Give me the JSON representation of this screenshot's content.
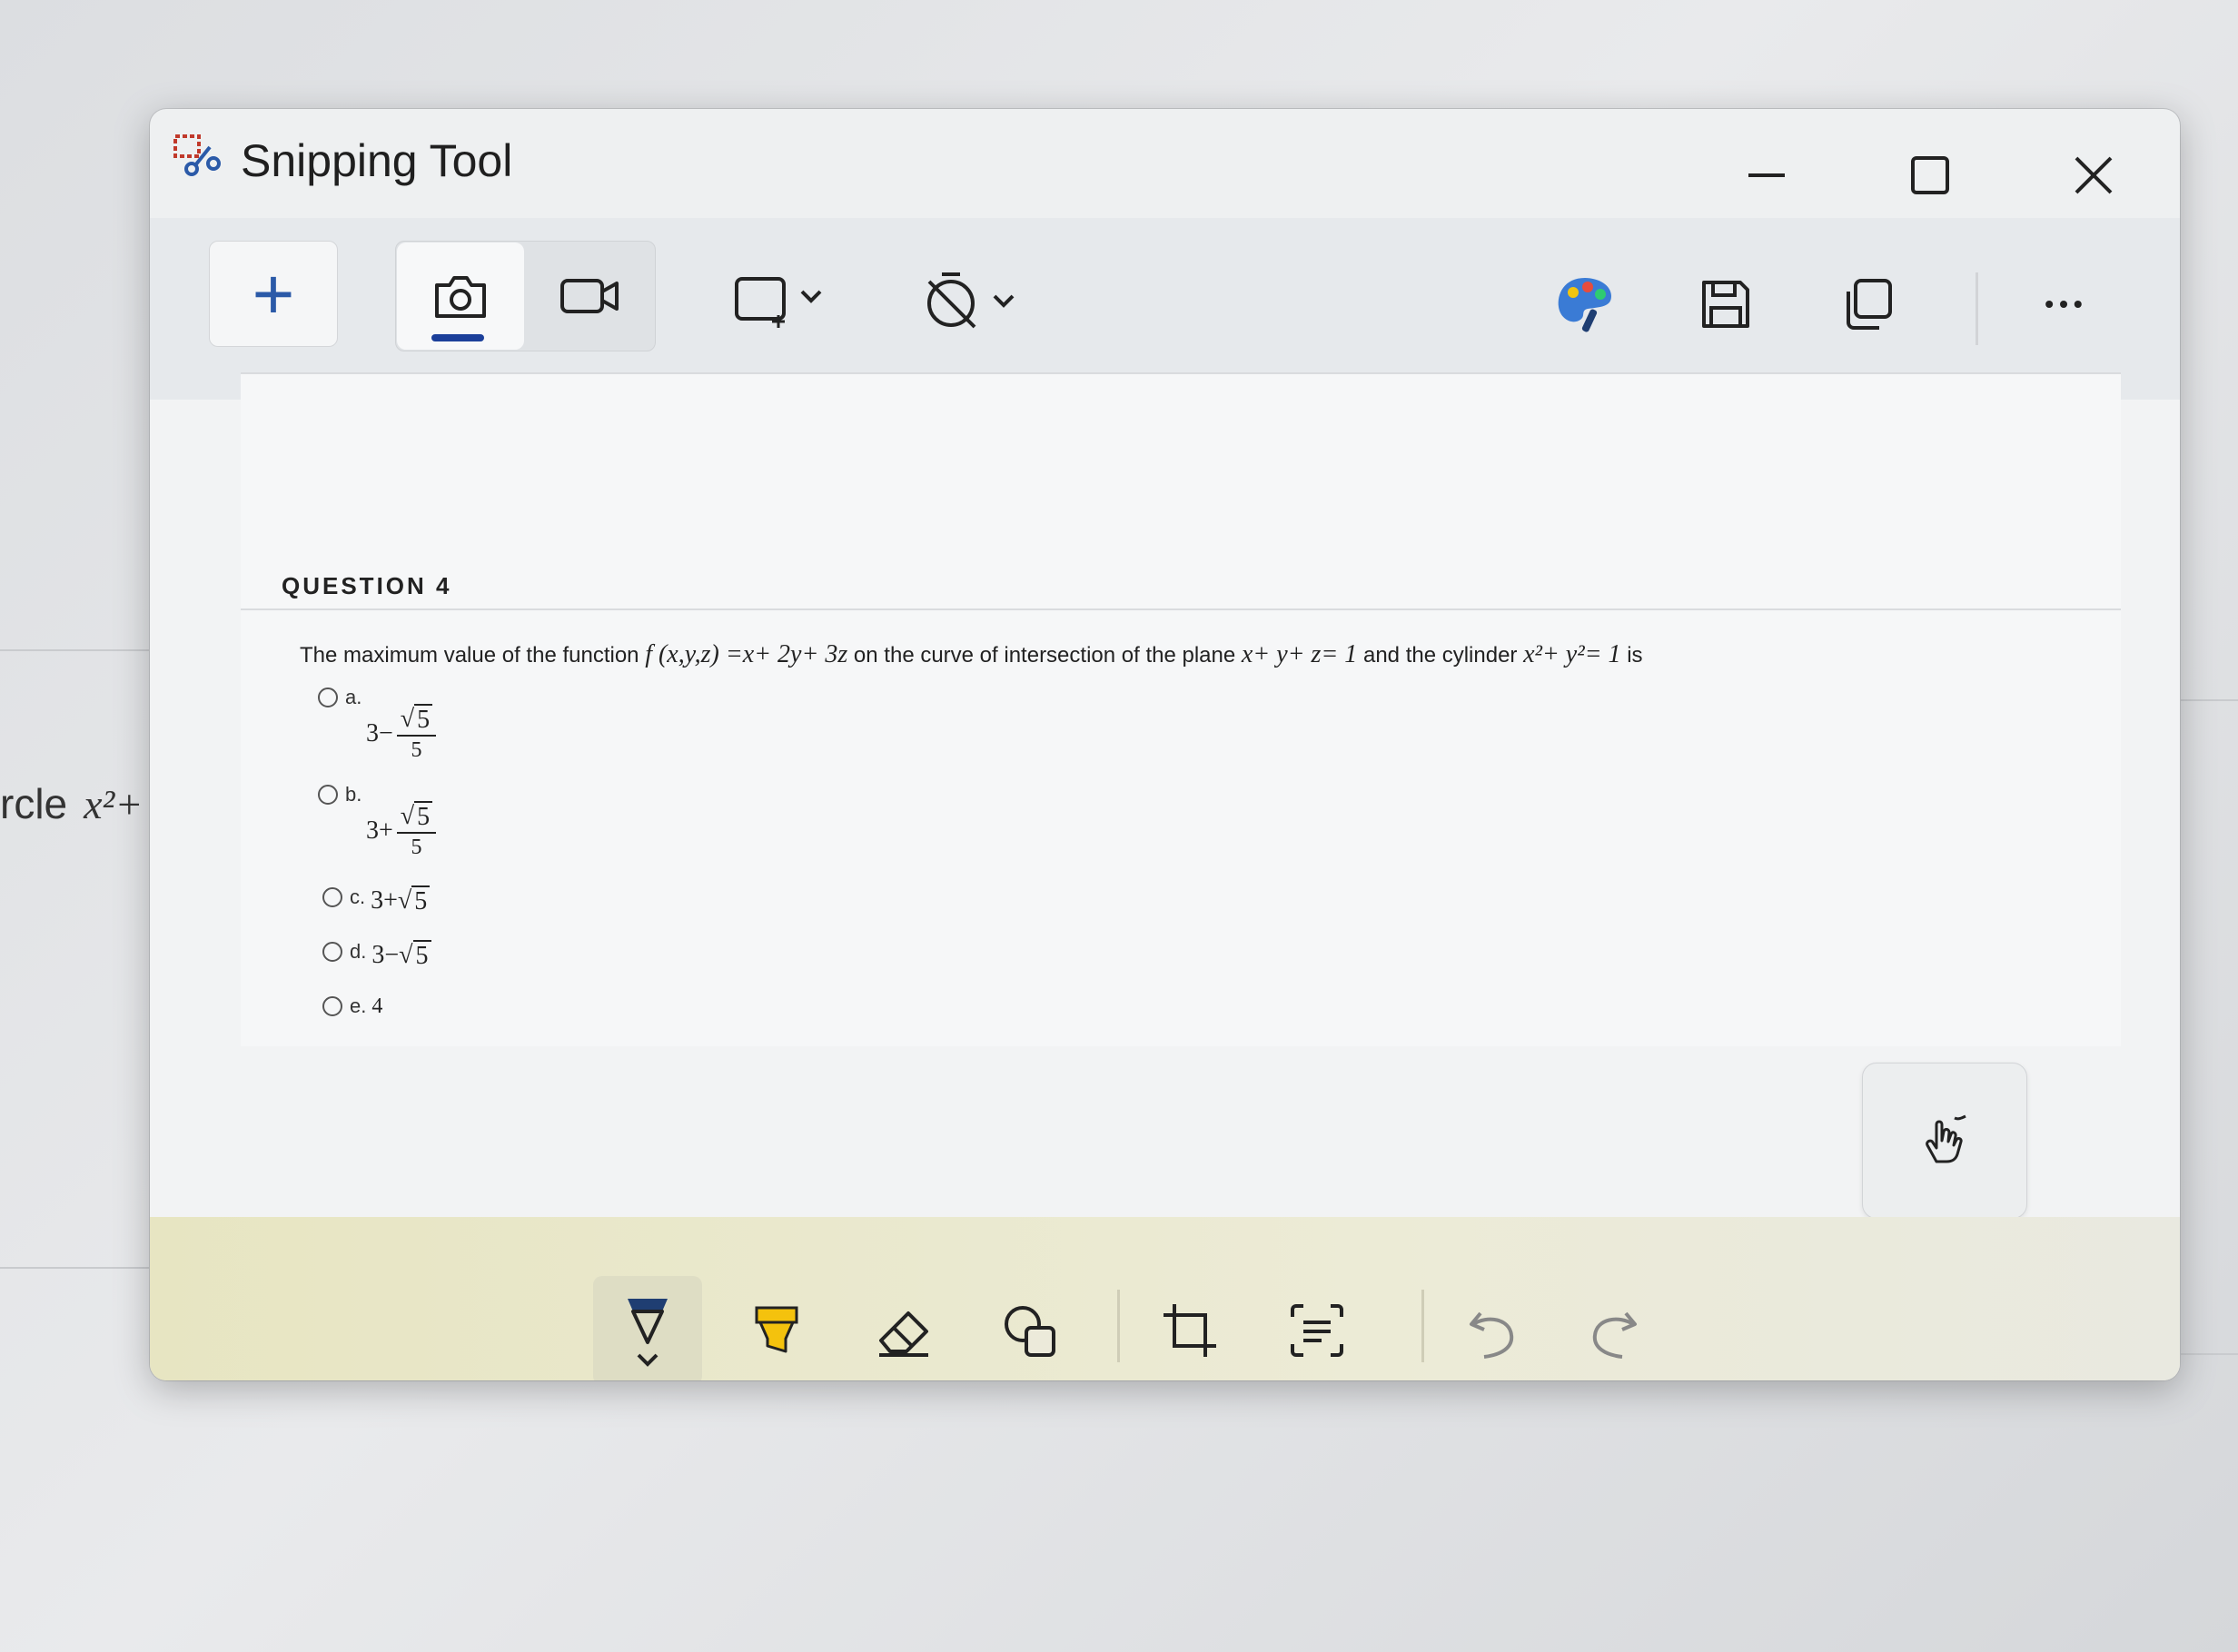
{
  "background": {
    "partial_text": "rcle",
    "partial_math": "x²+"
  },
  "window": {
    "title": "Snipping Tool"
  },
  "toolbar": {
    "new_label": "+",
    "more_label": "•••"
  },
  "question": {
    "heading": "QUESTION 4",
    "text_part1": "The maximum value of the function ",
    "func": "f (x,y,z) =x+ 2y+ 3z",
    "text_part2": " on the curve of intersection of the plane ",
    "plane": "x+ y+ z= 1",
    "text_part3": " and the cylinder ",
    "cylinder": "x²+ y²= 1",
    "text_part4": " is",
    "options": [
      {
        "letter": "a.",
        "prefix": "3−",
        "num": "5",
        "den": "5"
      },
      {
        "letter": "b.",
        "prefix": "3+",
        "num": "5",
        "den": "5"
      },
      {
        "letter": "c.",
        "expr_prefix": "3+",
        "radicand": "5"
      },
      {
        "letter": "d.",
        "expr_prefix": "3−",
        "radicand": "5"
      },
      {
        "letter": "e.",
        "value": "4"
      }
    ]
  },
  "icons": {
    "app": "snipping-tool-icon",
    "minimize": "minimize-icon",
    "maximize": "maximize-icon",
    "close": "close-icon",
    "camera": "camera-icon",
    "video": "video-icon",
    "rect_mode": "rectangle-mode-icon",
    "timer": "no-timer-icon",
    "paint": "paint-icon",
    "save": "save-icon",
    "copy": "copy-icon",
    "touch": "touch-writing-icon",
    "pen": "ballpoint-pen-icon",
    "highlighter": "highlighter-icon",
    "eraser": "eraser-icon",
    "shapes": "shapes-icon",
    "crop": "crop-icon",
    "text_actions": "text-actions-icon",
    "undo": "undo-icon",
    "redo": "redo-icon"
  }
}
